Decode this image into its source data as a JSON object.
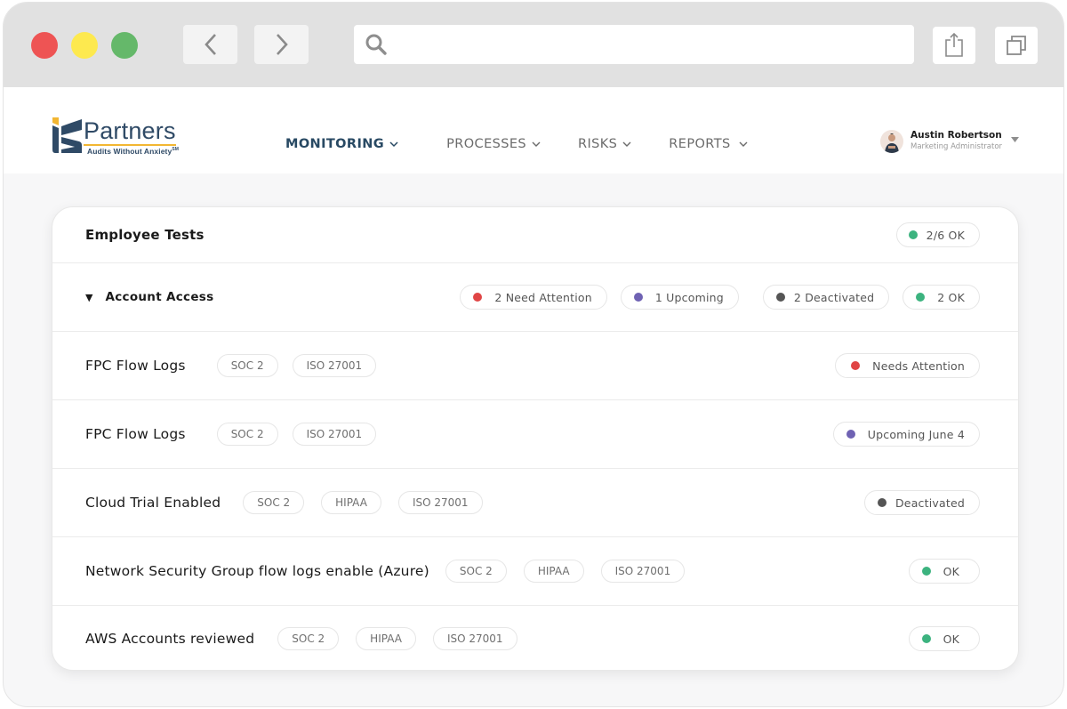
{
  "browser": {
    "search_placeholder": "",
    "icons": {
      "back": "chevron-left-icon",
      "forward": "chevron-right-icon",
      "search": "search-icon",
      "share": "share-icon",
      "tabs": "tabs-icon"
    }
  },
  "brand": {
    "name": "Partners",
    "tagline": "Audits Without Anxiety",
    "tagline_mark": "SM",
    "colors": {
      "primary": "#2f4a66",
      "accent": "#f2b632"
    }
  },
  "nav": {
    "items": [
      {
        "label": "MONITORING",
        "active": true
      },
      {
        "label": "PROCESSES",
        "active": false
      },
      {
        "label": "RISKS",
        "active": false
      },
      {
        "label": "REPORTS",
        "active": false
      }
    ]
  },
  "user": {
    "name": "Austin Robertson",
    "role": "Marketing Administrator"
  },
  "status_colors": {
    "attention": "#e04545",
    "upcoming": "#6f62b3",
    "deactivated": "#555555",
    "ok": "#3cb37f"
  },
  "card": {
    "title": "Employee Tests",
    "summary": {
      "label": "2/6 OK",
      "status": "ok"
    },
    "group": {
      "title": "Account Access",
      "expanded": true,
      "counts": [
        {
          "label": "2 Need Attention",
          "status": "attention"
        },
        {
          "label": "1 Upcoming",
          "status": "upcoming"
        },
        {
          "label": "2 Deactivated",
          "status": "deactivated"
        },
        {
          "label": "2 OK",
          "status": "ok"
        }
      ]
    },
    "tests": [
      {
        "name": "FPC Flow Logs",
        "tags": [
          "SOC 2",
          "ISO 27001"
        ],
        "status_label": "Needs Attention",
        "status": "attention"
      },
      {
        "name": "FPC Flow Logs",
        "tags": [
          "SOC 2",
          "ISO 27001"
        ],
        "status_label": "Upcoming June 4",
        "status": "upcoming"
      },
      {
        "name": "Cloud Trial Enabled",
        "tags": [
          "SOC 2",
          "HIPAA",
          "ISO 27001"
        ],
        "status_label": "Deactivated",
        "status": "deactivated"
      },
      {
        "name": "Network Security Group flow logs enable (Azure)",
        "tags": [
          "SOC 2",
          "HIPAA",
          "ISO 27001"
        ],
        "status_label": "OK",
        "status": "ok"
      },
      {
        "name": "AWS Accounts reviewed",
        "tags": [
          "SOC 2",
          "HIPAA",
          "ISO 27001"
        ],
        "status_label": "OK",
        "status": "ok"
      }
    ]
  }
}
